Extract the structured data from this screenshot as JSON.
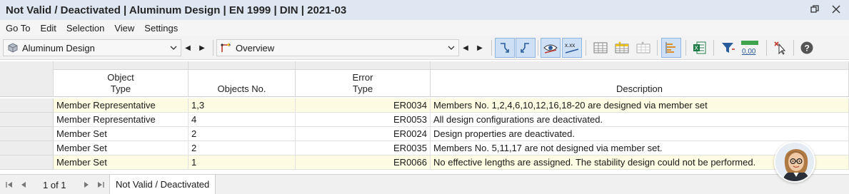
{
  "window": {
    "title": "Not Valid / Deactivated | Aluminum Design | EN 1999 | DIN | 2021-03"
  },
  "menu": [
    "Go To",
    "Edit",
    "Selection",
    "View",
    "Settings"
  ],
  "toolbar": {
    "module_select": "Aluminum Design",
    "view_select": "Overview"
  },
  "table": {
    "headers": {
      "object_type": "Object\nType",
      "objects_no": "Objects No.",
      "error_type": "Error\nType",
      "description": "Description"
    },
    "rows": [
      {
        "object_type": "Member Representative",
        "objects_no": "1,3",
        "error_type": "ER0034",
        "description": "Members No. 1,2,4,6,10,12,16,18-20 are designed via member set"
      },
      {
        "object_type": "Member Representative",
        "objects_no": "4",
        "error_type": "ER0053",
        "description": "All design configurations are deactivated."
      },
      {
        "object_type": "Member Set",
        "objects_no": "2",
        "error_type": "ER0024",
        "description": "Design properties are deactivated."
      },
      {
        "object_type": "Member Set",
        "objects_no": "2",
        "error_type": "ER0035",
        "description": "Members No. 5,11,17 are not designed via member set."
      },
      {
        "object_type": "Member Set",
        "objects_no": "1",
        "error_type": "ER0066",
        "description": "No effective lengths are assigned. The stability design could not be performed."
      }
    ]
  },
  "footer": {
    "page_info": "1 of 1",
    "tab_label": "Not Valid / Deactivated"
  },
  "colors": {
    "titlebar_bg": "#dfe7f2",
    "highlight_row": "#fdfbe1",
    "active_button": "#cde0f5"
  }
}
